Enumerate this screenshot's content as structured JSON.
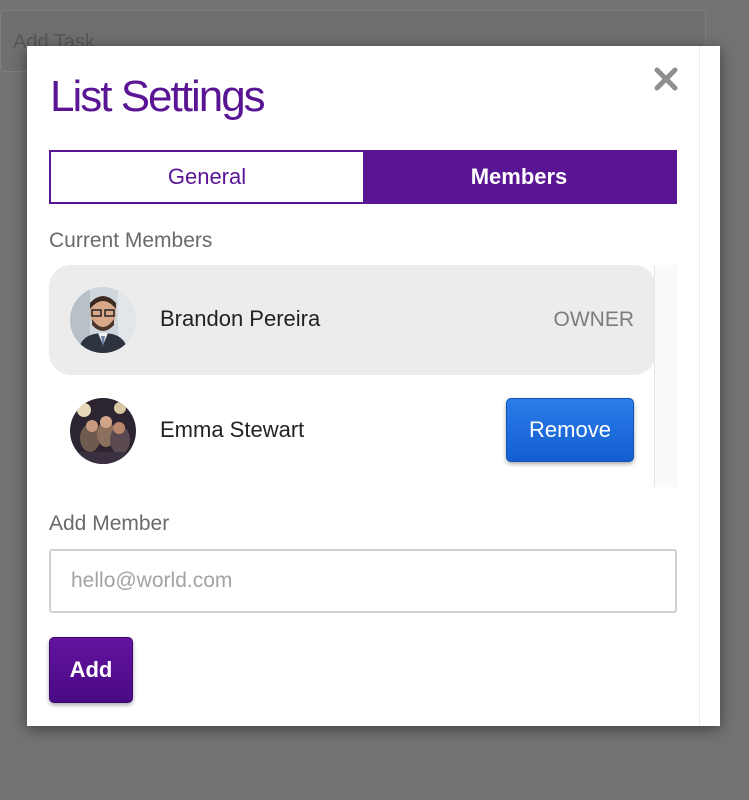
{
  "background": {
    "add_task_placeholder": "Add Task"
  },
  "modal": {
    "title": "List Settings",
    "close_icon": "close-icon",
    "accent_color": "#5a1594",
    "tabs": [
      {
        "label": "General",
        "active": false
      },
      {
        "label": "Members",
        "active": true
      }
    ],
    "current_members_label": "Current Members",
    "members": [
      {
        "name": "Brandon Pereira",
        "role": "OWNER",
        "avatar": "avatar-photo-man"
      },
      {
        "name": "Emma Stewart",
        "action_label": "Remove",
        "avatar": "avatar-photo-group"
      }
    ],
    "add_member_label": "Add Member",
    "email_placeholder": "hello@world.com",
    "email_value": "",
    "add_button_label": "Add",
    "remove_button_color": "#1f6fdd"
  }
}
